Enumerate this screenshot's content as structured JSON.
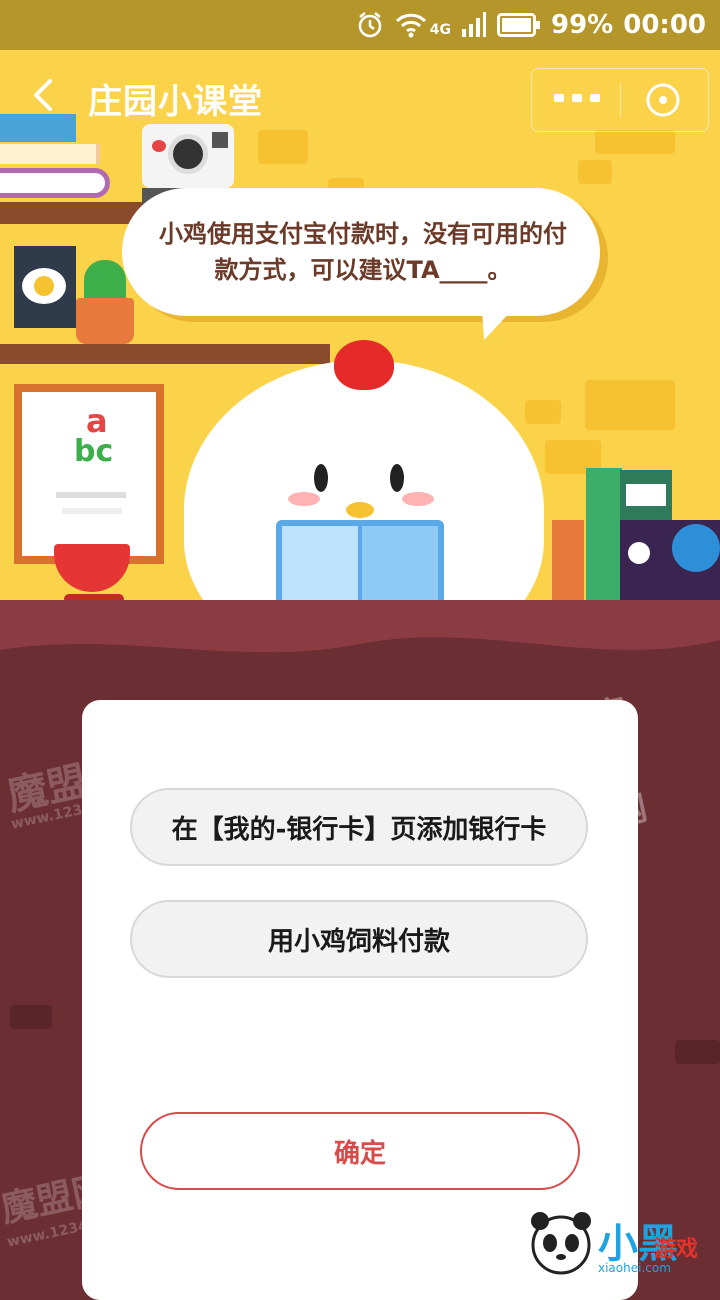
{
  "status_bar": {
    "battery": "99%",
    "time": "00:00",
    "network": "4G"
  },
  "nav": {
    "title": "庄园小课堂"
  },
  "question": {
    "text": "小鸡使用支付宝付款时，没有可用的付款方式，可以建议TA____。"
  },
  "options": [
    {
      "label": "在【我的-银行卡】页添加银行卡"
    },
    {
      "label": "用小鸡饲料付款"
    }
  ],
  "confirm_label": "确定",
  "illustration": {
    "frame_text_top": "a",
    "frame_text_bottom": "bc"
  },
  "watermarks": {
    "site_name": "魔盟网",
    "site_url": "www.12349.net"
  },
  "logo": {
    "brand": "小黑",
    "brand_sub": "游戏",
    "url": "xiaohei.com"
  },
  "colors": {
    "status_bg": "#b5962a",
    "scene_bg": "#fbd34a",
    "page_bg": "#6b2e33",
    "confirm_accent": "#d94a4a"
  }
}
